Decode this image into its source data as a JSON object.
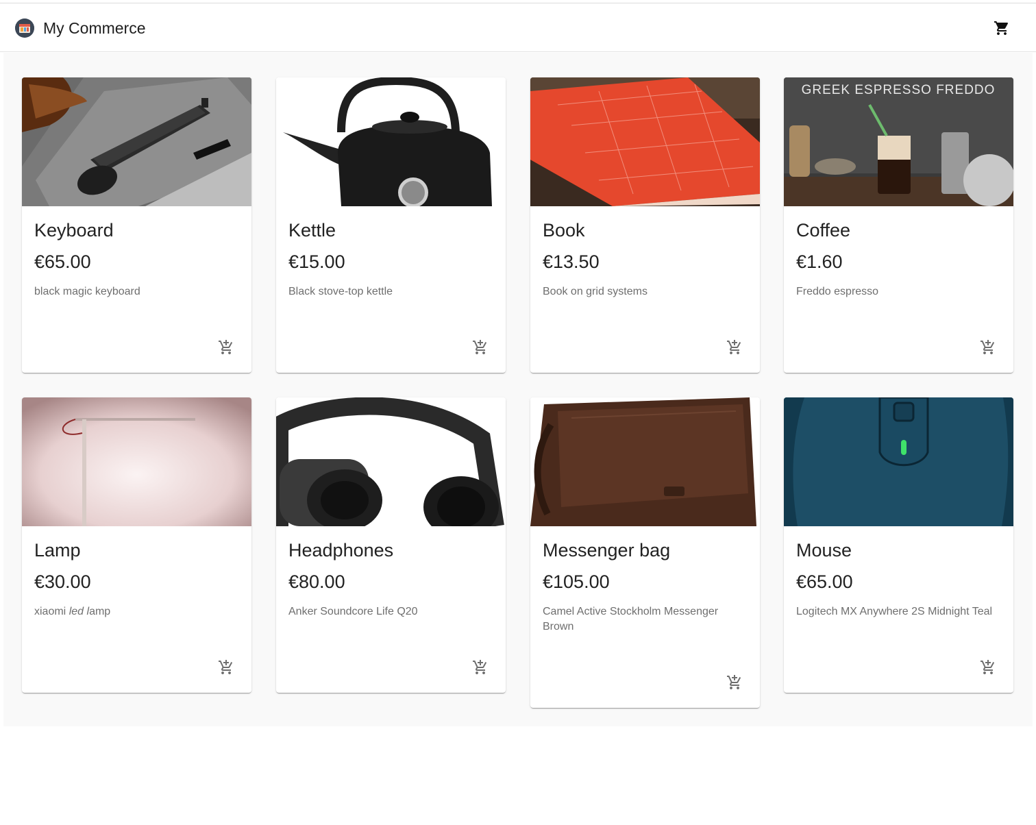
{
  "app": {
    "title": "My Commerce",
    "cart_icon": "shopping-cart-icon",
    "logo_icon": "store-logo-icon"
  },
  "products": [
    {
      "title": "Keyboard",
      "price": "€65.00",
      "description": "black magic keyboard",
      "image": "keyboard-photo"
    },
    {
      "title": "Kettle",
      "price": "€15.00",
      "description": "Black stove-top kettle",
      "image": "kettle-photo"
    },
    {
      "title": "Book",
      "price": "€13.50",
      "description": "Book on grid systems",
      "image": "book-photo"
    },
    {
      "title": "Coffee",
      "price": "€1.60",
      "description": "Freddo espresso",
      "image": "coffee-photo",
      "image_text": "GREEK ESPRESSO FREDDO"
    },
    {
      "title": "Lamp",
      "price": "€30.00",
      "description_parts": [
        "xiaomi ",
        "led",
        " ",
        "l",
        "amp"
      ],
      "image": "lamp-photo"
    },
    {
      "title": "Headphones",
      "price": "€80.00",
      "description": "Anker Soundcore Life Q20",
      "image": "headphones-photo"
    },
    {
      "title": "Messenger bag",
      "price": "€105.00",
      "description": "Camel Active Stockholm Messenger Brown",
      "image": "messenger-bag-photo"
    },
    {
      "title": "Mouse",
      "price": "€65.00",
      "description": "Logitech MX Anywhere 2S Midnight Teal",
      "image": "mouse-photo"
    }
  ],
  "add_to_cart_icon": "add-shopping-cart-icon"
}
